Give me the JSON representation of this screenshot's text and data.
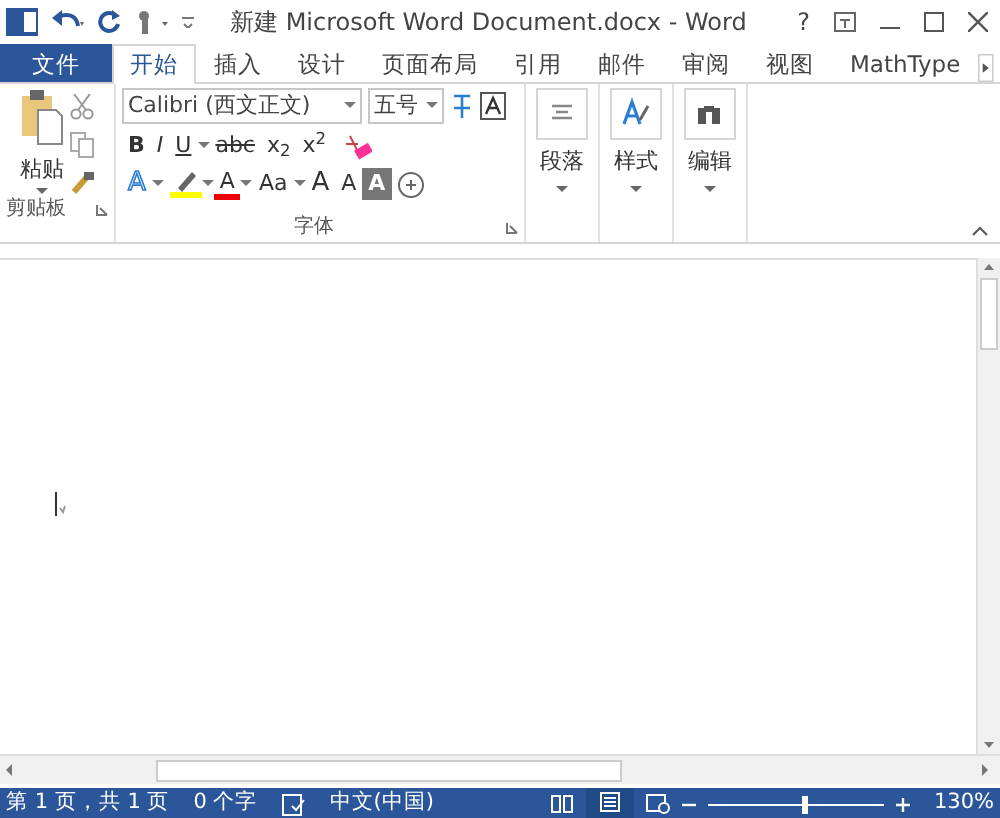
{
  "title_bar": {
    "title": "新建 Microsoft Word Document.docx - Word",
    "help": "?"
  },
  "tabs": [
    {
      "label": "文件",
      "kind": "file",
      "selected": false
    },
    {
      "label": "开始",
      "kind": "tab",
      "selected": true
    },
    {
      "label": "插入",
      "kind": "tab",
      "selected": false
    },
    {
      "label": "设计",
      "kind": "tab",
      "selected": false
    },
    {
      "label": "页面布局",
      "kind": "tab",
      "selected": false
    },
    {
      "label": "引用",
      "kind": "tab",
      "selected": false
    },
    {
      "label": "邮件",
      "kind": "tab",
      "selected": false
    },
    {
      "label": "审阅",
      "kind": "tab",
      "selected": false
    },
    {
      "label": "视图",
      "kind": "tab",
      "selected": false
    },
    {
      "label": "MathType",
      "kind": "tab",
      "selected": false
    }
  ],
  "ribbon": {
    "clipboard": {
      "paste": "粘贴",
      "label": "剪贴板"
    },
    "font": {
      "name": "Calibri (西文正文)",
      "size": "五号",
      "label": "字体",
      "row1": [
        {
          "label": "B",
          "kind": "bold"
        },
        {
          "label": "I",
          "kind": "italic"
        },
        {
          "label": "U",
          "kind": "underline"
        },
        {
          "label": "abc",
          "kind": "strike"
        },
        {
          "label": "x$_{2}$",
          "kind": "plain"
        },
        {
          "label": "x$^{2}$",
          "kind": "plain"
        }
      ],
      "row2": [
        {
          "label": "A",
          "kind": "effect"
        },
        {
          "label": "A",
          "kind": "color"
        },
        {
          "label": "Aa",
          "kind": "plain"
        },
        {
          "label": "A",
          "kind": "grow"
        },
        {
          "label": "A",
          "kind": "shrink"
        },
        {
          "label": "A",
          "kind": "shade"
        }
      ]
    },
    "groups": [
      {
        "label": "段落",
        "kind": "paragraph"
      },
      {
        "label": "样式",
        "kind": "styles"
      },
      {
        "label": "编辑",
        "kind": "editing"
      }
    ]
  },
  "status_bar": {
    "page": "第 1 页，共 1 页",
    "words": "0 个字",
    "language": "中文(中国)",
    "zoom": "130%",
    "zoom_slider": {
      "level": 0.55
    }
  }
}
